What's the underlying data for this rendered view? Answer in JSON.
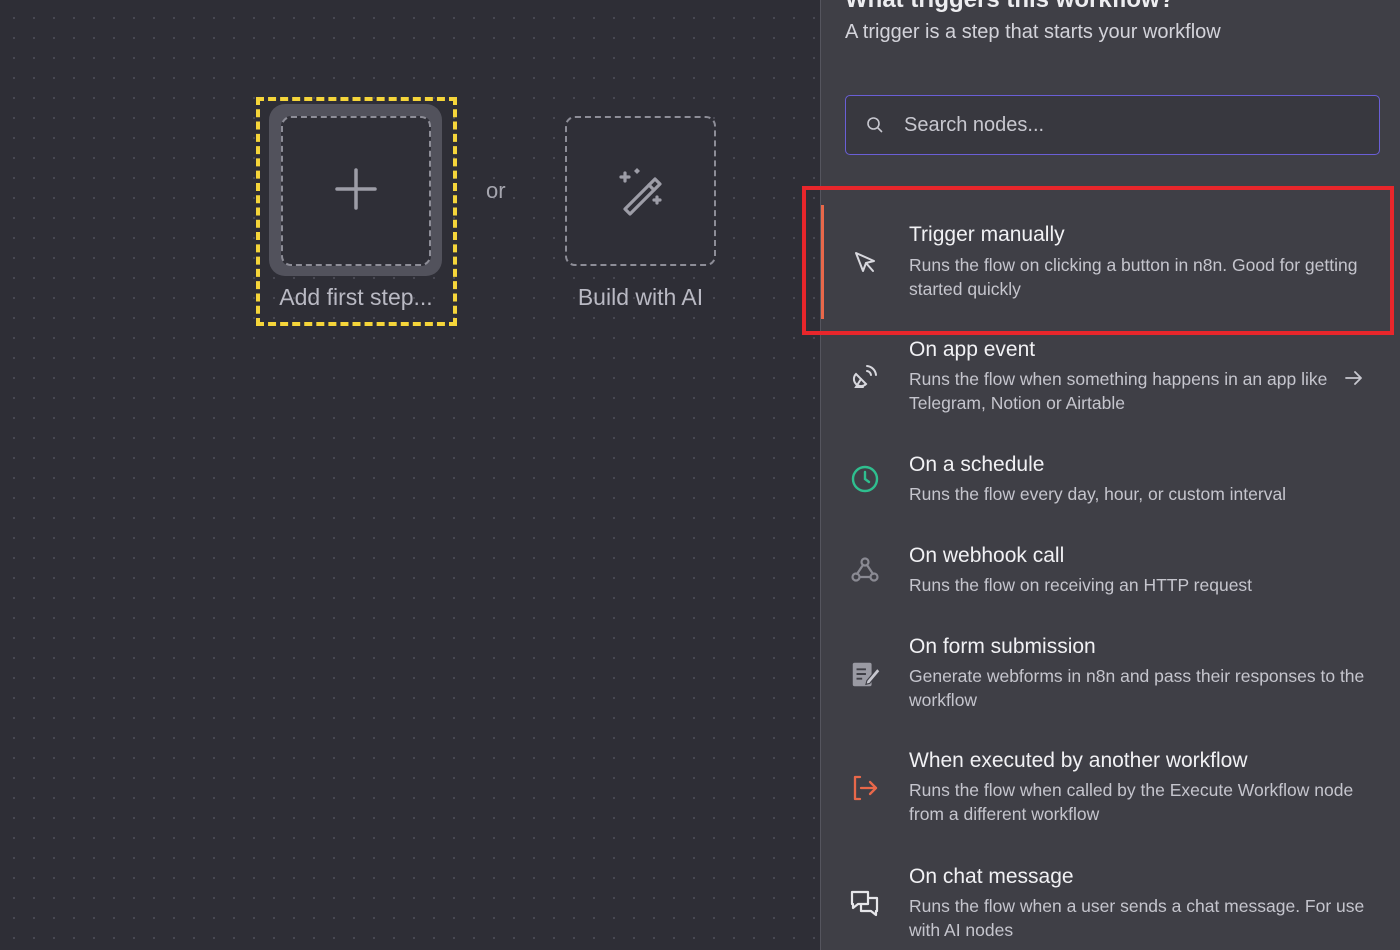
{
  "canvas": {
    "add_step_label": "Add first step...",
    "or_label": "or",
    "build_ai_label": "Build with AI"
  },
  "panel": {
    "title": "What triggers this workflow?",
    "subtitle": "A trigger is a step that starts your workflow",
    "search": {
      "placeholder": "Search nodes...",
      "value": ""
    },
    "items": [
      {
        "title": "Trigger manually",
        "desc": "Runs the flow on clicking a button in n8n. Good for getting started quickly",
        "icon": "cursor-icon",
        "selected": true
      },
      {
        "title": "On app event",
        "desc": "Runs the flow when something happens in an app like Telegram, Notion or Airtable",
        "icon": "satellite-icon",
        "has_arrow": true
      },
      {
        "title": "On a schedule",
        "desc": "Runs the flow every day, hour, or custom interval",
        "icon": "clock-icon"
      },
      {
        "title": "On webhook call",
        "desc": "Runs the flow on receiving an HTTP request",
        "icon": "webhook-icon"
      },
      {
        "title": "On form submission",
        "desc": "Generate webforms in n8n and pass their responses to the workflow",
        "icon": "form-icon"
      },
      {
        "title": "When executed by another workflow",
        "desc": "Runs the flow when called by the Execute Workflow node from a different workflow",
        "icon": "sign-in-icon"
      },
      {
        "title": "On chat message",
        "desc": "Runs the flow when a user sends a chat message. For use with AI nodes",
        "icon": "chat-icon"
      }
    ]
  },
  "colors": {
    "accent": "#e8684a",
    "schedule": "#2fbf8f",
    "search_border": "#6a5fd6"
  }
}
